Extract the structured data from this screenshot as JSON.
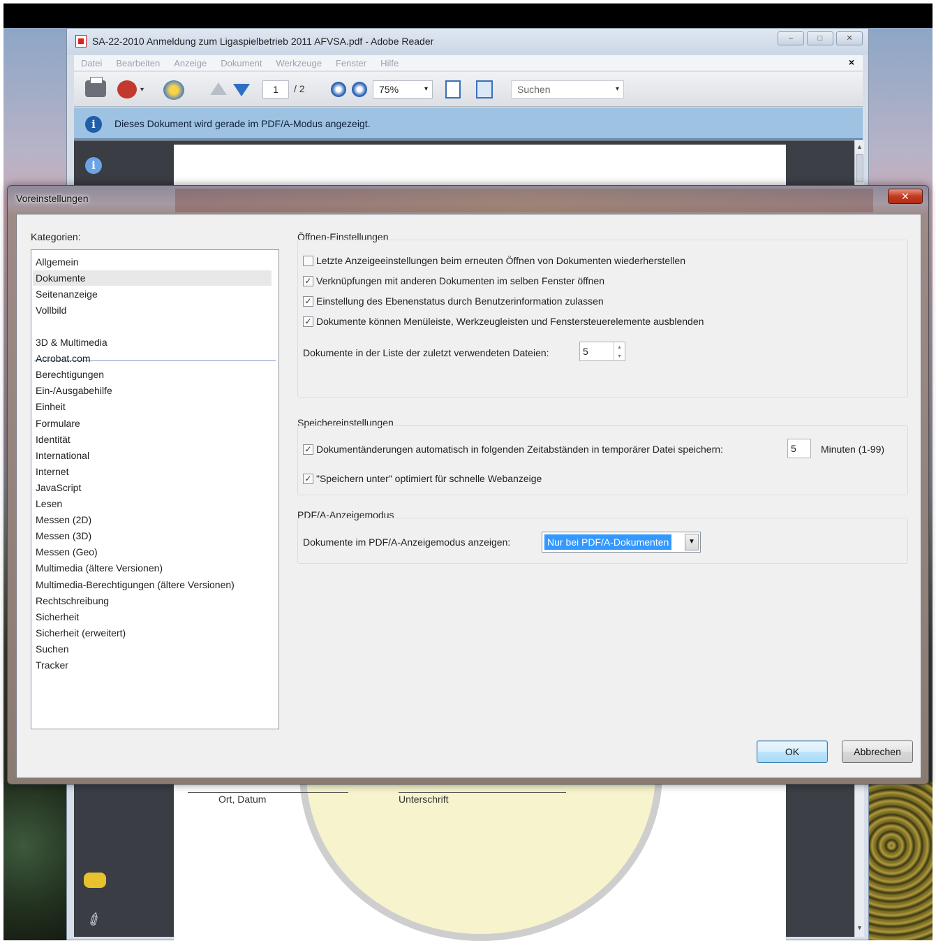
{
  "reader": {
    "title": "SA-22-2010 Anmeldung zum Ligaspielbetrieb 2011 AFVSA.pdf - Adobe Reader",
    "window_buttons": [
      "–",
      "□",
      "✕"
    ],
    "menu": [
      "Datei",
      "Bearbeiten",
      "Anzeige",
      "Dokument",
      "Werkzeuge",
      "Fenster",
      "Hilfe"
    ],
    "menu_close": "×",
    "toolbar": {
      "page_current": "1",
      "page_total": "/ 2",
      "zoom": "75%",
      "search_placeholder": "Suchen"
    },
    "infobar_text": "Dieses Dokument wird gerade im PDF/A-Modus angezeigt.",
    "document": {
      "ort_label": "Ort, Datum",
      "signature_label": "Unterschrift"
    }
  },
  "dialog": {
    "title": "Voreinstellungen",
    "close": "✕",
    "categories_label": "Kategorien:",
    "categories_top": [
      "Allgemein",
      "Dokumente",
      "Seitenanzeige",
      "Vollbild"
    ],
    "categories": [
      "3D & Multimedia",
      "Acrobat.com",
      "Berechtigungen",
      "Ein-/Ausgabehilfe",
      "Einheit",
      "Formulare",
      "Identität",
      "International",
      "Internet",
      "JavaScript",
      "Lesen",
      "Messen (2D)",
      "Messen (3D)",
      "Messen (Geo)",
      "Multimedia (ältere Versionen)",
      "Multimedia-Berechtigungen (ältere Versionen)",
      "Rechtschreibung",
      "Sicherheit",
      "Sicherheit (erweitert)",
      "Suchen",
      "Tracker"
    ],
    "selected_category": "Dokumente",
    "open_settings": {
      "title": "Öffnen-Einstellungen",
      "checks": [
        {
          "label": "Letzte Anzeigeeinstellungen beim erneuten Öffnen von Dokumenten wiederherstellen",
          "checked": false
        },
        {
          "label": "Verknüpfungen mit anderen Dokumenten im selben Fenster öffnen",
          "checked": true
        },
        {
          "label": "Einstellung des Ebenenstatus durch Benutzerinformation zulassen",
          "checked": true
        },
        {
          "label": "Dokumente können Menüleiste, Werkzeugleisten und Fenstersteuerelemente ausblenden",
          "checked": true
        }
      ],
      "recent_label": "Dokumente in der Liste der zuletzt verwendeten Dateien:",
      "recent_value": "5"
    },
    "save_settings": {
      "title": "Speichereinstellungen",
      "autosave_label": "Dokumentänderungen automatisch in folgenden Zeitabständen in temporärer Datei speichern:",
      "autosave_checked": true,
      "autosave_value": "5",
      "autosave_unit": "Minuten (1-99)",
      "saveas_label": "\"Speichern unter\" optimiert für schnelle Webanzeige",
      "saveas_checked": true
    },
    "pdfa": {
      "title": "PDF/A-Anzeigemodus",
      "label": "Dokumente im PDF/A-Anzeigemodus anzeigen:",
      "value": "Nur bei PDF/A-Dokumenten"
    },
    "ok": "OK",
    "cancel": "Abbrechen"
  },
  "icons": {
    "check_mark": "✓",
    "dropdown_caret": "▾",
    "spin_up": "▴",
    "spin_down": "▾",
    "scroll_up": "▲",
    "scroll_down": "▼",
    "paperclip": "✐",
    "info": "i"
  }
}
